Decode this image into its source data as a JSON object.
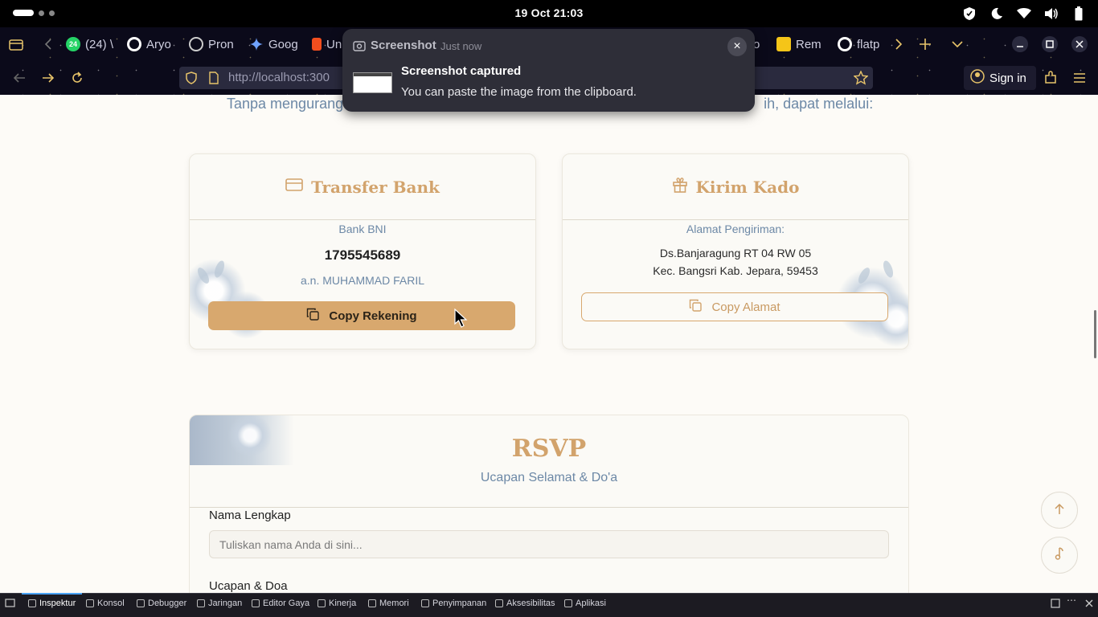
{
  "topbar": {
    "clock": "19 Oct  21:03"
  },
  "tabs": [
    {
      "label": "(24) \\",
      "badge": "24"
    },
    {
      "label": "Aryo"
    },
    {
      "label": "Pron"
    },
    {
      "label": "Goog"
    },
    {
      "label": "Un"
    },
    {
      "label": "o"
    },
    {
      "label": "Rem"
    },
    {
      "label": "flatp"
    }
  ],
  "navbar": {
    "url_host": "http://localhost:300",
    "signin": "Sign in"
  },
  "notification": {
    "app": "Screenshot",
    "time": "Just now",
    "title": "Screenshot captured",
    "body": "You can paste the image from the clipboard."
  },
  "page": {
    "intro_left": "Tanpa mengurang",
    "intro_right": "ih, dapat melalui:",
    "bank": {
      "title": "Transfer Bank",
      "bank_name": "Bank BNI",
      "account_number": "1795545689",
      "account_holder": "a.n. MUHAMMAD FARIL",
      "button": "Copy Rekening"
    },
    "gift": {
      "title": "Kirim Kado",
      "address_label": "Alamat Pengiriman:",
      "address_line1": "Ds.Banjaragung RT 04 RW 05",
      "address_line2": "Kec. Bangsri Kab. Jepara, 59453",
      "button": "Copy Alamat"
    },
    "rsvp": {
      "title": "RSVP",
      "subtitle": "Ucapan Selamat & Do'a",
      "name_label": "Nama Lengkap",
      "name_placeholder": "Tuliskan nama Anda di sini...",
      "wish_label": "Ucapan & Doa"
    }
  },
  "devtools": [
    {
      "label": "Inspektur",
      "icon": "inspector-icon"
    },
    {
      "label": "Konsol",
      "icon": "console-icon"
    },
    {
      "label": "Debugger",
      "icon": "debugger-icon"
    },
    {
      "label": "Jaringan",
      "icon": "network-icon"
    },
    {
      "label": "Editor Gaya",
      "icon": "style-editor-icon"
    },
    {
      "label": "Kinerja",
      "icon": "performance-icon"
    },
    {
      "label": "Memori",
      "icon": "memory-icon"
    },
    {
      "label": "Penyimpanan",
      "icon": "storage-icon"
    },
    {
      "label": "Aksesibilitas",
      "icon": "accessibility-icon"
    },
    {
      "label": "Aplikasi",
      "icon": "application-icon"
    }
  ],
  "colors": {
    "accent": "#d8a86e",
    "muted_blue": "#6c88a6",
    "page_bg": "#fdfbf7"
  }
}
